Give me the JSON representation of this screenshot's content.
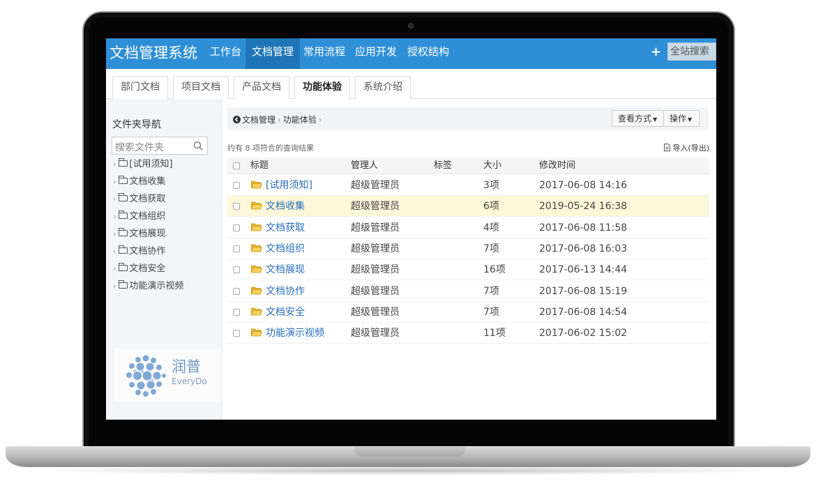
{
  "app": {
    "title": "文档管理系统"
  },
  "nav": {
    "items": [
      {
        "label": "工作台",
        "active": false
      },
      {
        "label": "文档管理",
        "active": true
      },
      {
        "label": "常用流程",
        "active": false
      },
      {
        "label": "应用开发",
        "active": false
      },
      {
        "label": "授权结构",
        "active": false
      }
    ],
    "plus_label": "+",
    "search_label": "全站搜索"
  },
  "tabs": [
    {
      "label": "部门文档",
      "active": false
    },
    {
      "label": "项目文档",
      "active": false
    },
    {
      "label": "产品文档",
      "active": false
    },
    {
      "label": "功能体验",
      "active": true
    },
    {
      "label": "系统介绍",
      "active": false
    }
  ],
  "sidebar": {
    "title": "文件夹导航",
    "search_placeholder": "搜索文件夹",
    "items": [
      {
        "label": "[试用须知]"
      },
      {
        "label": "文档收集"
      },
      {
        "label": "文档获取"
      },
      {
        "label": "文档组织"
      },
      {
        "label": "文档展现"
      },
      {
        "label": "文档协作"
      },
      {
        "label": "文档安全"
      },
      {
        "label": "功能演示视频"
      }
    ],
    "logo": {
      "name": "润普",
      "sub": "EveryDo"
    }
  },
  "breadcrumb": {
    "items": [
      {
        "label": "文档管理"
      },
      {
        "label": "功能体验"
      }
    ],
    "sep": "›"
  },
  "toolbar": {
    "view_label": "查看方式",
    "ops_label": "操作"
  },
  "results": {
    "count_text": "约有 8 项符合的查询结果",
    "import_label": "导入(导出)"
  },
  "table": {
    "headers": {
      "title": "标题",
      "manager": "管理人",
      "tag": "标签",
      "size": "大小",
      "mtime": "修改时间"
    },
    "rows": [
      {
        "title": "[试用须知]",
        "manager": "超级管理员",
        "tag": "",
        "size": "3项",
        "mtime": "2017-06-08 14:16",
        "highlight": false
      },
      {
        "title": "文档收集",
        "manager": "超级管理员",
        "tag": "",
        "size": "6项",
        "mtime": "2019-05-24 16:38",
        "highlight": true
      },
      {
        "title": "文档获取",
        "manager": "超级管理员",
        "tag": "",
        "size": "4项",
        "mtime": "2017-06-08 11:58",
        "highlight": false
      },
      {
        "title": "文档组织",
        "manager": "超级管理员",
        "tag": "",
        "size": "7项",
        "mtime": "2017-06-08 16:03",
        "highlight": false
      },
      {
        "title": "文档展现",
        "manager": "超级管理员",
        "tag": "",
        "size": "16项",
        "mtime": "2017-06-13 14:44",
        "highlight": false
      },
      {
        "title": "文档协作",
        "manager": "超级管理员",
        "tag": "",
        "size": "7项",
        "mtime": "2017-06-08 15:19",
        "highlight": false
      },
      {
        "title": "文档安全",
        "manager": "超级管理员",
        "tag": "",
        "size": "7项",
        "mtime": "2017-06-08 14:54",
        "highlight": false
      },
      {
        "title": "功能演示视频",
        "manager": "超级管理员",
        "tag": "",
        "size": "11项",
        "mtime": "2017-06-02 15:02",
        "highlight": false
      }
    ]
  },
  "colors": {
    "nav_bg": "#2f8fd6",
    "nav_active": "#1f75b8",
    "link": "#2a6ebb",
    "row_highlight": "#fcf8d9",
    "folder": "#f2c443"
  }
}
